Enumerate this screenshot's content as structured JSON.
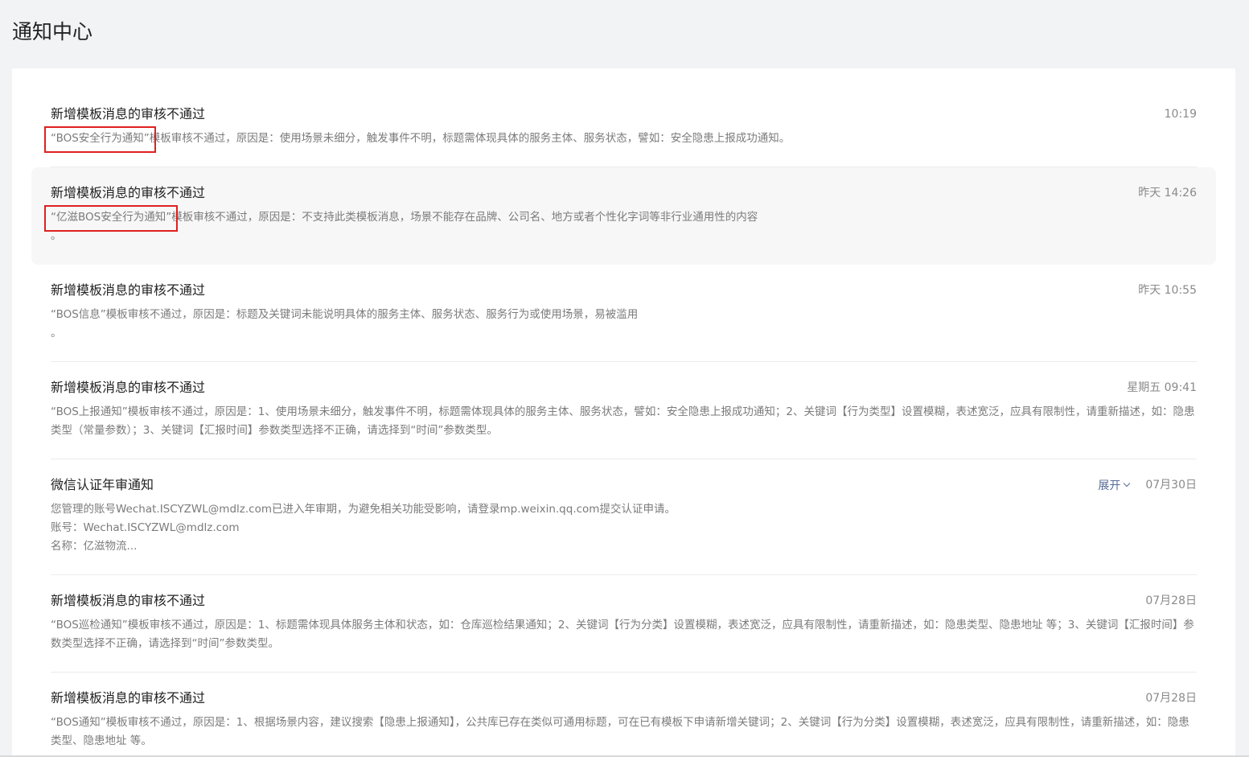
{
  "page": {
    "title": "通知中心"
  },
  "expand_label": "展开",
  "notifications": [
    {
      "title": "新增模板消息的审核不通过",
      "time": "10:19",
      "highlight": "“BOS安全行为通知”",
      "body": "模板审核不通过，原因是：使用场景未细分，触发事件不明，标题需体现具体的服务主体、服务状态，譬如：安全隐患上报成功通知。"
    },
    {
      "title": "新增模板消息的审核不通过",
      "time": "昨天 14:26",
      "highlight": "“亿滋BOS安全行为通知”",
      "body": "模板审核不通过，原因是：不支持此类模板消息，场景不能存在品牌、公司名、地方或者个性化字词等非行业通用性的内容",
      "tail": "。"
    },
    {
      "title": "新增模板消息的审核不通过",
      "time": "昨天 10:55",
      "body": "“BOS信息”模板审核不通过，原因是：标题及关键词未能说明具体的服务主体、服务状态、服务行为或使用场景，易被滥用",
      "tail": "。"
    },
    {
      "title": "新增模板消息的审核不通过",
      "time": "星期五 09:41",
      "body": "“BOS上报通知”模板审核不通过，原因是：1、使用场景未细分，触发事件不明，标题需体现具体的服务主体、服务状态，譬如：安全隐患上报成功通知；2、关键词【行为类型】设置模糊，表述宽泛，应具有限制性，请重新描述，如：隐患类型（常量参数）；3、关键词【汇报时间】参数类型选择不正确，请选择到“时间”参数类型。"
    },
    {
      "title": "微信认证年审通知",
      "time": "07月30日",
      "expandable": true,
      "body": "您管理的账号Wechat.ISCYZWL@mdlz.com已进入年审期，为避免相关功能受影响，请登录mp.weixin.qq.com提交认证申请。",
      "line2": "账号：Wechat.ISCYZWL@mdlz.com",
      "line3": "名称：亿滋物流..."
    },
    {
      "title": "新增模板消息的审核不通过",
      "time": "07月28日",
      "body": "“BOS巡检通知”模板审核不通过，原因是：1、标题需体现具体服务主体和状态，如：仓库巡检结果通知；2、关键词【行为分类】设置模糊，表述宽泛，应具有限制性，请重新描述，如：隐患类型、隐患地址 等；3、关键词【汇报时间】参数类型选择不正确，请选择到“时间”参数类型。"
    },
    {
      "title": "新增模板消息的审核不通过",
      "time": "07月28日",
      "body": "“BOS通知”模板审核不通过，原因是：1、根据场景内容，建议搜索【隐患上报通知】，公共库已存在类似可通用标题，可在已有模板下申请新增关键词；2、关键词【行为分类】设置模糊，表述宽泛，应具有限制性，请重新描述，如：隐患类型、隐患地址 等。"
    }
  ]
}
